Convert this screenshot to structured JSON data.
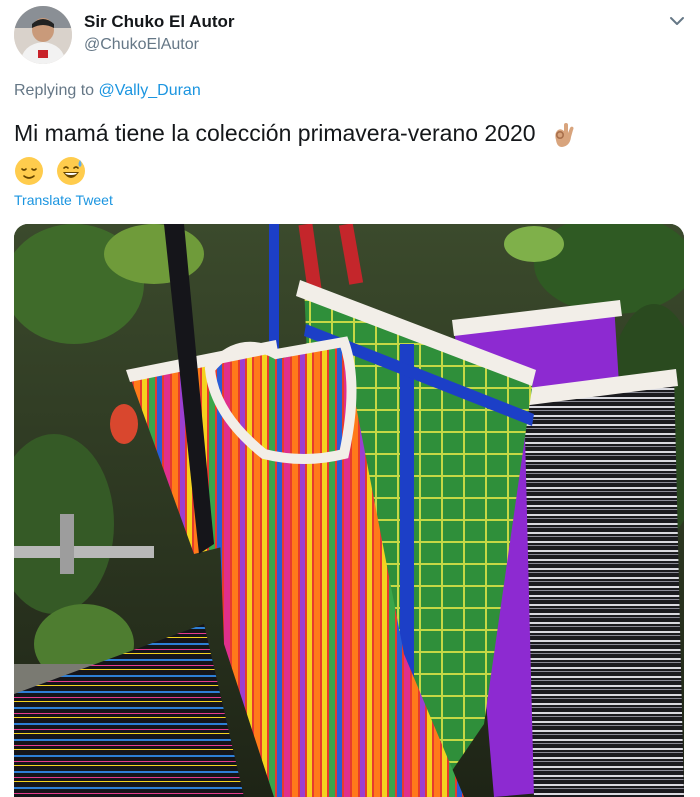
{
  "user": {
    "name": "Sir Chuko El Autor",
    "handle": "@ChukoElAutor",
    "avatar_icon": "profile-photo-icon"
  },
  "reply": {
    "prefix": "Replying to",
    "mention": "@Vally_Duran"
  },
  "tweet": {
    "text": "Mi mamá tiene la colección primavera-verano 2020",
    "emojis": [
      "ok-hand-emoji",
      "relieved-face-emoji",
      "grinning-sweat-emoji"
    ],
    "translate_label": "Translate Tweet"
  },
  "media": {
    "icon": "photo-woven-market-bags-icon"
  },
  "colors": {
    "link": "#1b95e0",
    "secondary_text": "#657786",
    "primary_text": "#14171a"
  }
}
